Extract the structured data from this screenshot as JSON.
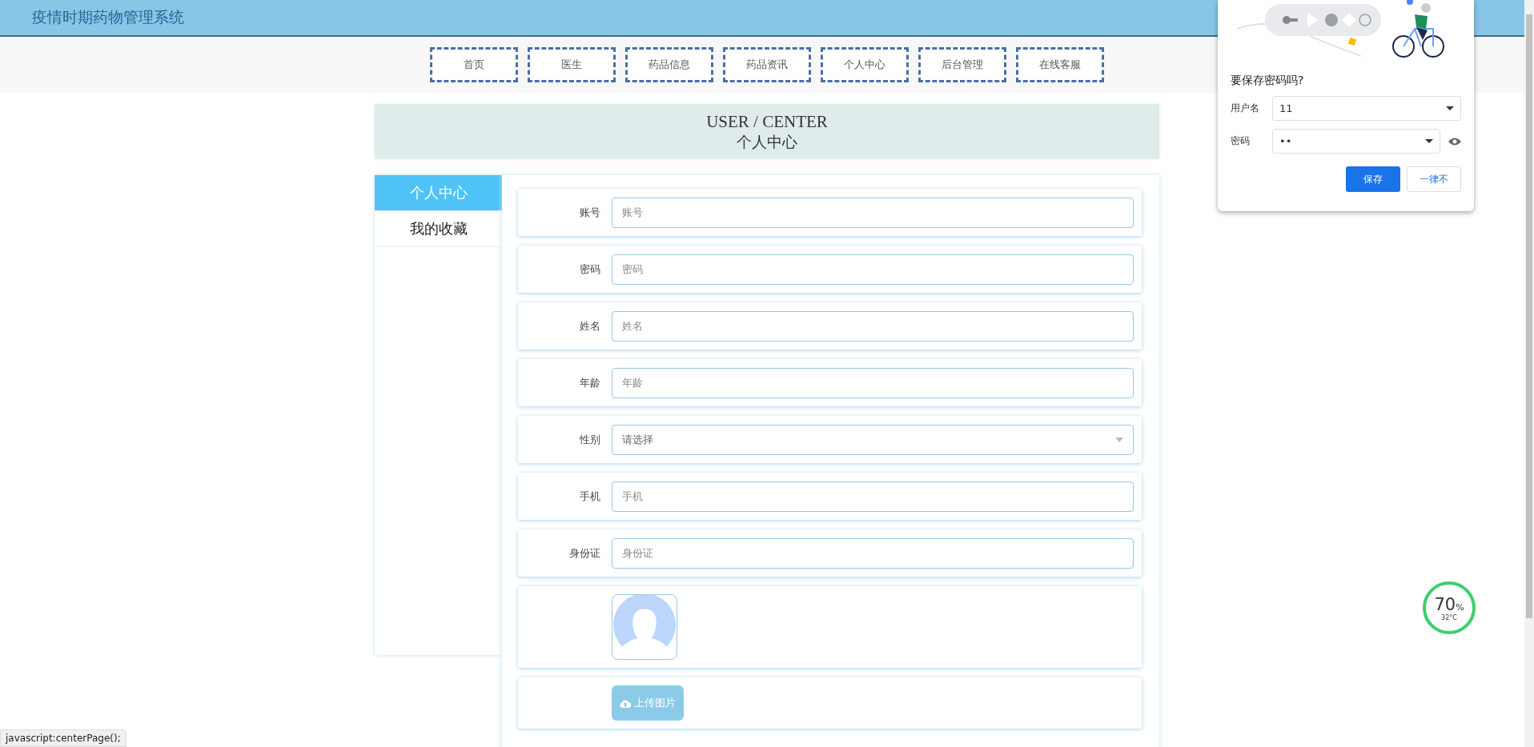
{
  "header": {
    "title": "疫情时期药物管理系统"
  },
  "nav": [
    {
      "label": "首页",
      "selected": false
    },
    {
      "label": "医生",
      "selected": false
    },
    {
      "label": "药品信息",
      "selected": false
    },
    {
      "label": "药品资讯",
      "selected": false
    },
    {
      "label": "个人中心",
      "selected": false
    },
    {
      "label": "后台管理",
      "selected": false
    },
    {
      "label": "在线客服",
      "selected": false
    }
  ],
  "banner": {
    "title": "USER / CENTER",
    "subtitle": "个人中心"
  },
  "sidebar": {
    "items": [
      {
        "label": "个人中心",
        "selected": true
      },
      {
        "label": "我的收藏",
        "selected": false
      }
    ]
  },
  "form": {
    "rows": [
      {
        "kind": "text",
        "label": "账号",
        "placeholder": "账号"
      },
      {
        "kind": "text",
        "label": "密码",
        "placeholder": "密码"
      },
      {
        "kind": "text",
        "label": "姓名",
        "placeholder": "姓名"
      },
      {
        "kind": "text",
        "label": "年龄",
        "placeholder": "年龄"
      },
      {
        "kind": "select",
        "label": "性别",
        "placeholder": "请选择"
      },
      {
        "kind": "text",
        "label": "手机",
        "placeholder": "手机"
      },
      {
        "kind": "text",
        "label": "身份证",
        "placeholder": "身份证"
      },
      {
        "kind": "avatar"
      },
      {
        "kind": "upload",
        "button": "上传图片"
      }
    ]
  },
  "save_password_popup": {
    "title": "要保存密码吗?",
    "username_label": "用户名",
    "username": "11",
    "password_label": "密码",
    "password": "••",
    "save_button": "保存",
    "never_button": "一律不"
  },
  "temperature_widget": {
    "percent": "70",
    "unit": "%",
    "temperature": "32°C"
  },
  "status_bar": {
    "url": "javascript:centerPage();"
  }
}
